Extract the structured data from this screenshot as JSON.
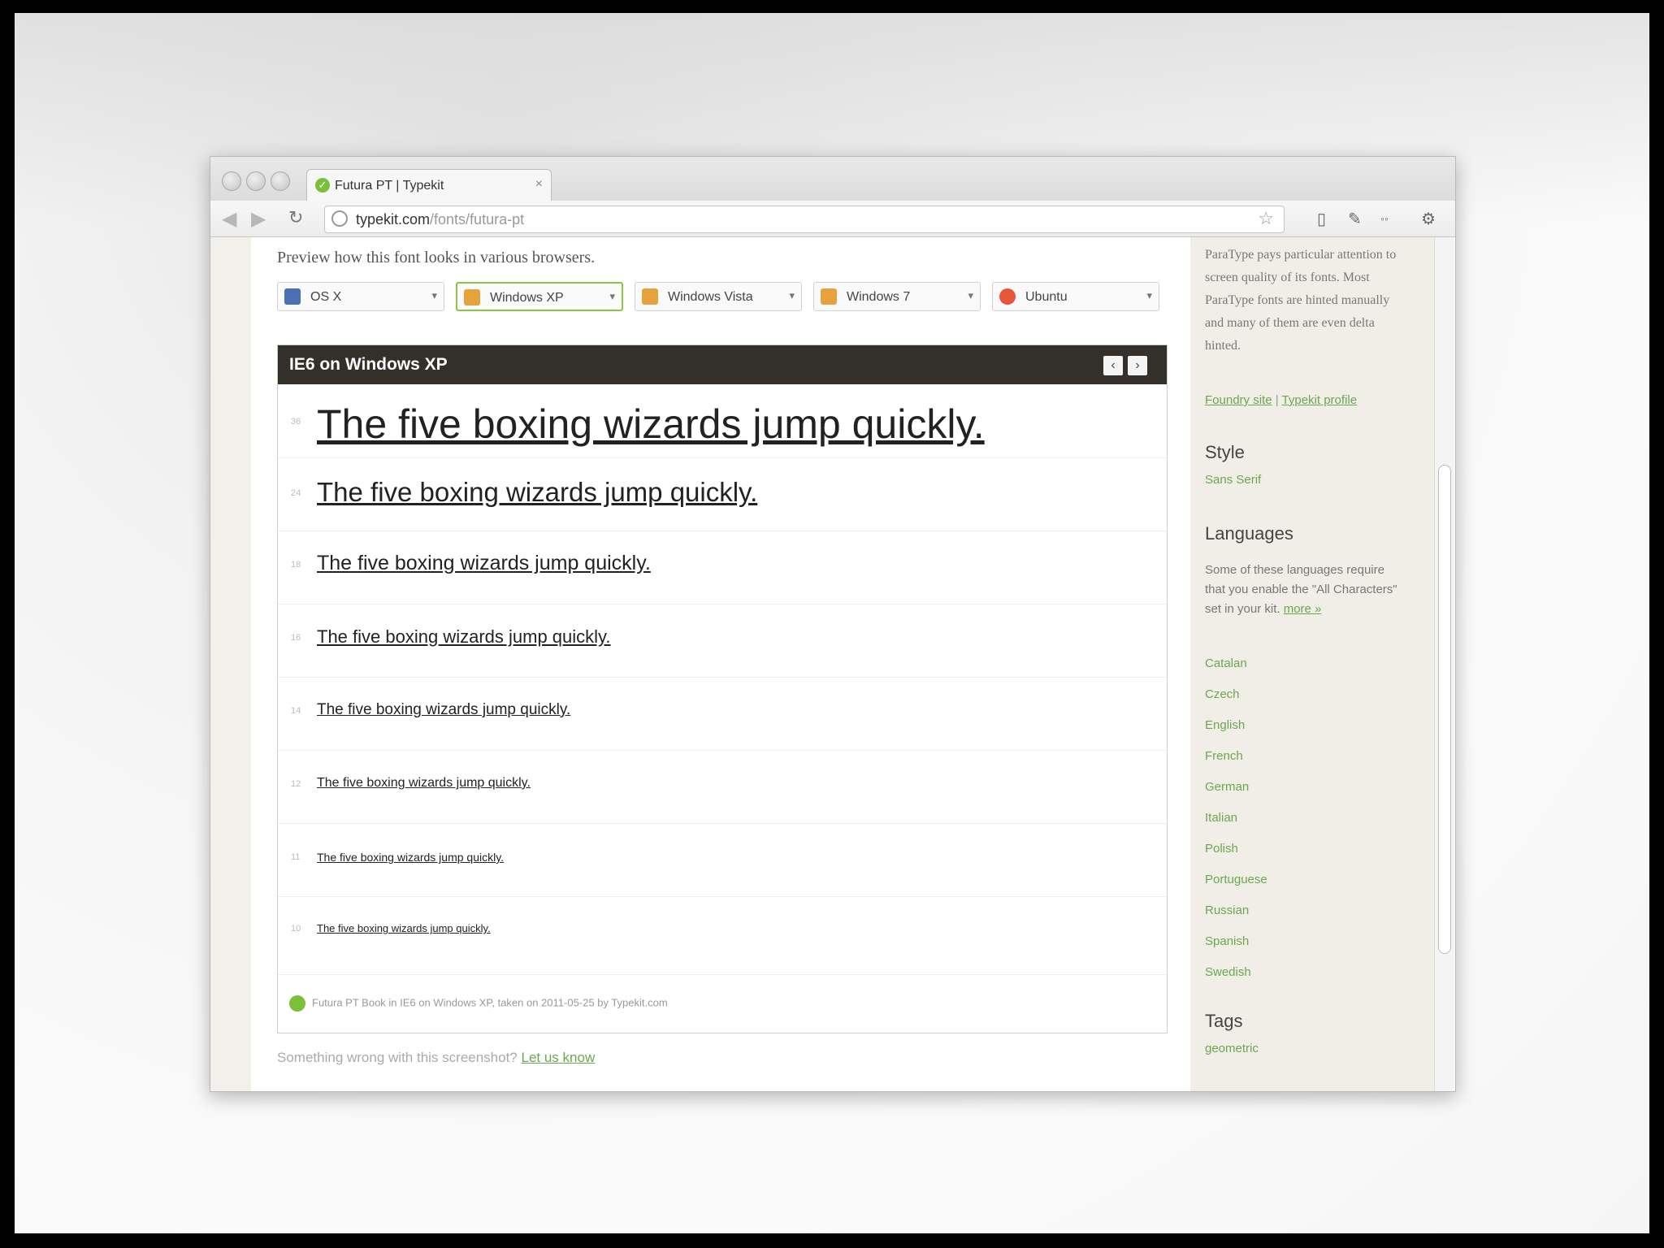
{
  "browser": {
    "tab_title": "Futura PT | Typekit",
    "tab_close": "×",
    "url_host": "typekit.com",
    "url_path": "/fonts/futura-pt"
  },
  "page": {
    "intro": "Preview how this font looks in various browsers.",
    "os_options": [
      {
        "label": "OS X",
        "color": "#4a6fb5"
      },
      {
        "label": "Windows XP",
        "color": "#e6a23c",
        "active": true
      },
      {
        "label": "Windows Vista",
        "color": "#e6a23c"
      },
      {
        "label": "Windows 7",
        "color": "#e6a23c"
      },
      {
        "label": "Ubuntu",
        "color": "#e8553b"
      }
    ],
    "specimen": {
      "header": "IE6 on Windows XP",
      "prev": "‹",
      "next": "›",
      "sample": "The five boxing wizards jump quickly.",
      "sizes": [
        "36",
        "24",
        "18",
        "16",
        "14",
        "12",
        "11",
        "10"
      ],
      "footer": "Futura PT Book in IE6 on Windows XP, taken on 2011-05-25 by Typekit.com"
    },
    "report": {
      "text": "Something wrong with this screenshot?",
      "link": "Let us know"
    }
  },
  "sidebar": {
    "about_text": "ParaType pays particular attention to screen quality of its fonts. Most ParaType fonts are hinted manually and many of them are even delta hinted.",
    "foundry_link": "Foundry site",
    "separator": "|",
    "profile_link": "Typekit profile",
    "style_heading": "Style",
    "style_value": "Sans Serif",
    "languages_heading": "Languages",
    "languages_note": "Some of these languages require that you enable the \"All Characters\" set in your kit.",
    "languages_more": "more »",
    "languages": [
      "Catalan",
      "Czech",
      "English",
      "French",
      "German",
      "Italian",
      "Polish",
      "Portuguese",
      "Russian",
      "Spanish",
      "Swedish"
    ],
    "tags_heading": "Tags",
    "tags_value": "geometric"
  }
}
